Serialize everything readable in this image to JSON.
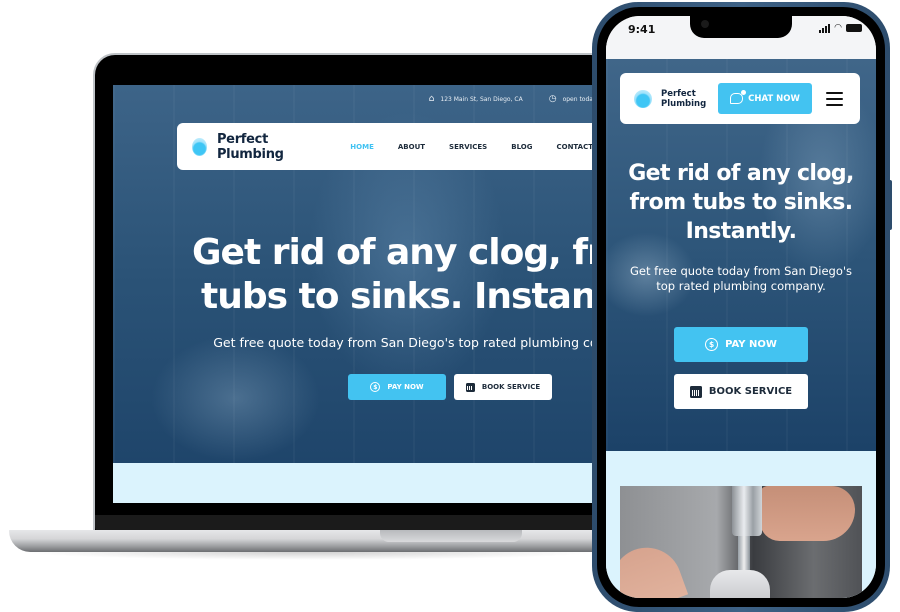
{
  "brand": {
    "name": "Perfect Plumbing",
    "name_line1": "Perfect",
    "name_line2": "Plumbing",
    "accent_color": "#43c3f1",
    "navy_color": "#12263f",
    "light_section_color": "#dbf3fd"
  },
  "desktop": {
    "topbar": {
      "address_icon": "map-icon",
      "address": "123 Main St, San Diego, CA",
      "hours_icon": "clock-icon",
      "hours": "open today fr"
    },
    "nav": [
      {
        "label": "HOME",
        "active": true
      },
      {
        "label": "ABOUT",
        "active": false
      },
      {
        "label": "SERVICES",
        "active": false
      },
      {
        "label": "BLOG",
        "active": false
      },
      {
        "label": "CONTACT",
        "active": false
      }
    ],
    "hero": {
      "line1": "Get rid of any clog, from",
      "line2": "tubs to sinks. Instantly.",
      "subtitle": "Get free quote today from San Diego's top rated plumbing company."
    },
    "buttons": {
      "pay_label": "PAY NOW",
      "pay_icon": "dollar-coin-icon",
      "book_label": "BOOK SERVICE",
      "book_icon": "calendar-icon"
    }
  },
  "mobile": {
    "status_bar": {
      "time": "9:41",
      "icons": [
        "signal-icon",
        "wifi-icon",
        "battery-icon"
      ]
    },
    "header": {
      "chat_label": "CHAT NOW",
      "chat_icon": "chat-bubble-icon",
      "menu_icon": "hamburger-menu-icon"
    },
    "hero": {
      "line1": "Get rid of any clog,",
      "line2": "from tubs to sinks.",
      "line3": "Instantly.",
      "subtitle_line1": "Get free quote today from San Diego's",
      "subtitle_line2": "top rated plumbing company."
    },
    "buttons": {
      "pay_label": "PAY NOW",
      "book_label": "BOOK SERVICE"
    },
    "photo_caption": "plumber-faucet-photo"
  },
  "glyphs": {
    "dollar": "$",
    "map": "⌂",
    "clock": "◷",
    "wifi": "◠"
  }
}
